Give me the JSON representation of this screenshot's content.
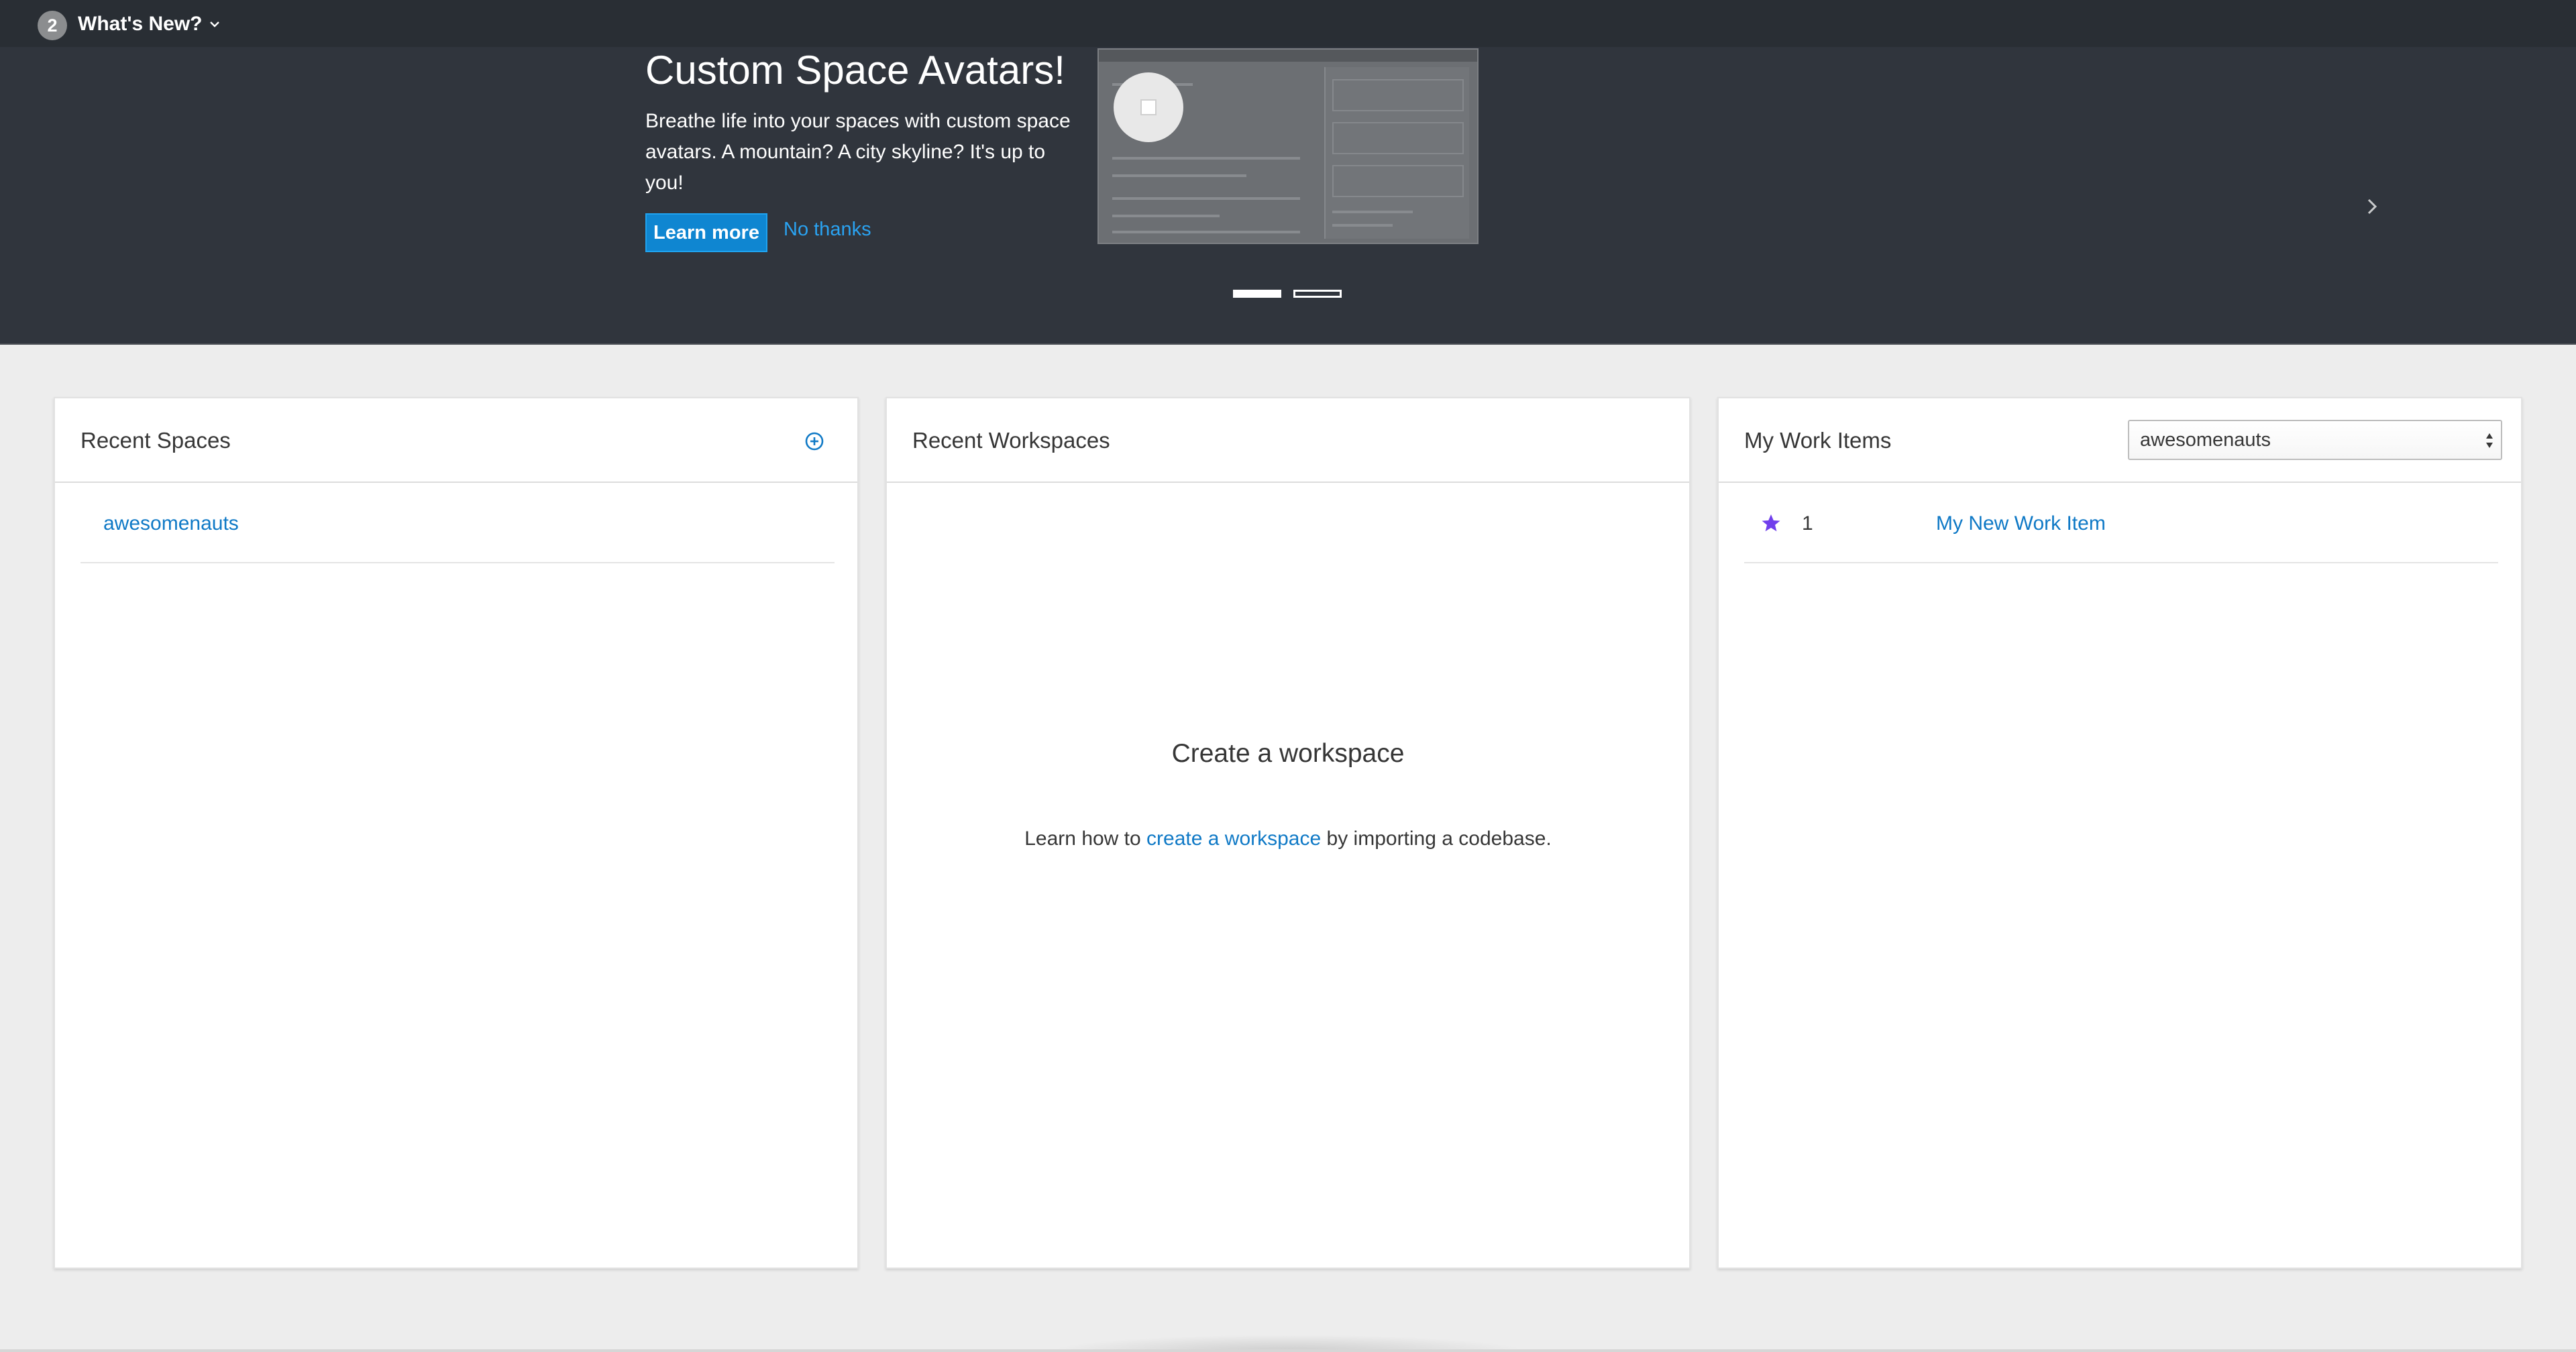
{
  "whats_new": {
    "badge_count": "2",
    "label": "What's New?",
    "feature": {
      "title": "Custom Space Avatars!",
      "description": "Breathe life into your spaces with custom space avatars. A mountain? A city skyline? It's up to you!",
      "learn_more_label": "Learn more",
      "no_thanks_label": "No thanks"
    },
    "carousel": {
      "slide_count": 2,
      "active_slide": 1
    },
    "icons": {
      "dropdown": "chevron-down-icon",
      "next": "chevron-right-icon"
    }
  },
  "recent_spaces": {
    "title": "Recent Spaces",
    "add_icon": "add-circle-icon",
    "items": [
      {
        "name": "awesomenauts"
      }
    ]
  },
  "recent_workspaces": {
    "title": "Recent Workspaces",
    "empty_title": "Create a workspace",
    "empty_text_before": "Learn how to ",
    "empty_link": "create a workspace",
    "empty_text_after": " by importing a codebase."
  },
  "my_work_items": {
    "title": "My Work Items",
    "filter": {
      "selected": "awesomenauts"
    },
    "items": [
      {
        "number": "1",
        "title": "My New Work Item",
        "icon": "star-icon"
      }
    ]
  },
  "colors": {
    "banner_bg": "#30353d",
    "link": "#0f79c6",
    "primary_button": "#0f86d1",
    "star": "#703fec"
  }
}
